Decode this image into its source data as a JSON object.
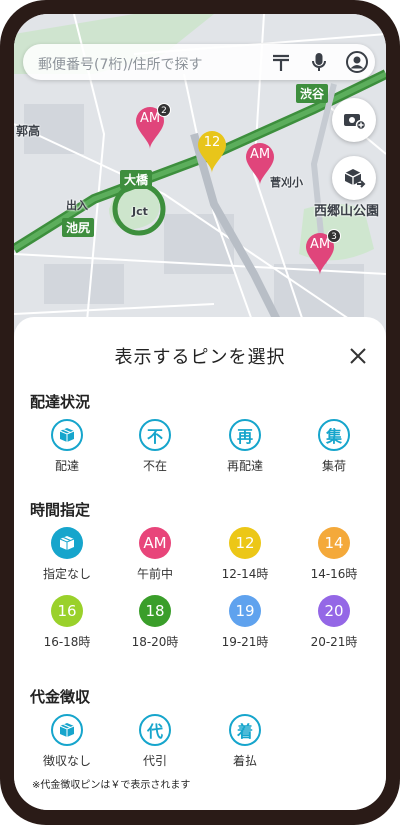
{
  "search": {
    "placeholder": "郵便番号(7桁)/住所で探す",
    "icons": [
      "postal-mark-icon",
      "microphone-icon",
      "account-icon"
    ]
  },
  "map": {
    "labels": {
      "shibuya": "渋谷",
      "ohashi": "大橋",
      "jct": "Jct",
      "ikejiri": "池尻",
      "ikejiri_top": "出入",
      "kamimeguro": "郭高",
      "school": "菅刈小",
      "park": "西郷山公園"
    },
    "pins": [
      {
        "name": "am-pin-1",
        "label": "AM",
        "badge": "2",
        "color": "#e0457b"
      },
      {
        "name": "twelve-pin",
        "label": "12",
        "badge": "",
        "color": "#e8c51a"
      },
      {
        "name": "am-pin-2",
        "label": "AM",
        "badge": "",
        "color": "#e0457b"
      },
      {
        "name": "am-pin-3",
        "label": "AM",
        "badge": "3",
        "color": "#e0457b"
      }
    ],
    "fabs": [
      "add-photo-icon",
      "delivery-truck-icon"
    ]
  },
  "sheet": {
    "title": "表示するピンを選択",
    "close_icon": "close-icon",
    "sections": {
      "delivery_status": {
        "title": "配達状況",
        "options": [
          {
            "label": "配達",
            "icon": "package-icon"
          },
          {
            "label": "不在",
            "glyph": "不"
          },
          {
            "label": "再配達",
            "glyph": "再"
          },
          {
            "label": "集荷",
            "glyph": "集"
          }
        ]
      },
      "time_slot": {
        "title": "時間指定",
        "options": [
          {
            "label": "指定なし",
            "icon": "package-icon",
            "color": "#16a5cc"
          },
          {
            "label": "午前中",
            "glyph": "AM",
            "color": "#e8457a"
          },
          {
            "label": "12-14時",
            "glyph": "12",
            "color": "#ecc717"
          },
          {
            "label": "14-16時",
            "glyph": "14",
            "color": "#f4a93a"
          },
          {
            "label": "16-18時",
            "glyph": "16",
            "color": "#9ad12b"
          },
          {
            "label": "18-20時",
            "glyph": "18",
            "color": "#3a9e2a"
          },
          {
            "label": "19-21時",
            "glyph": "19",
            "color": "#5fa2ee"
          },
          {
            "label": "20-21時",
            "glyph": "20",
            "color": "#9467e6"
          }
        ]
      },
      "cod": {
        "title": "代金徴収",
        "options": [
          {
            "label": "徴収なし",
            "icon": "package-icon"
          },
          {
            "label": "代引",
            "glyph": "代"
          },
          {
            "label": "着払",
            "glyph": "着"
          }
        ],
        "note": "※代金徴収ピンは￥で表示されます"
      }
    }
  }
}
